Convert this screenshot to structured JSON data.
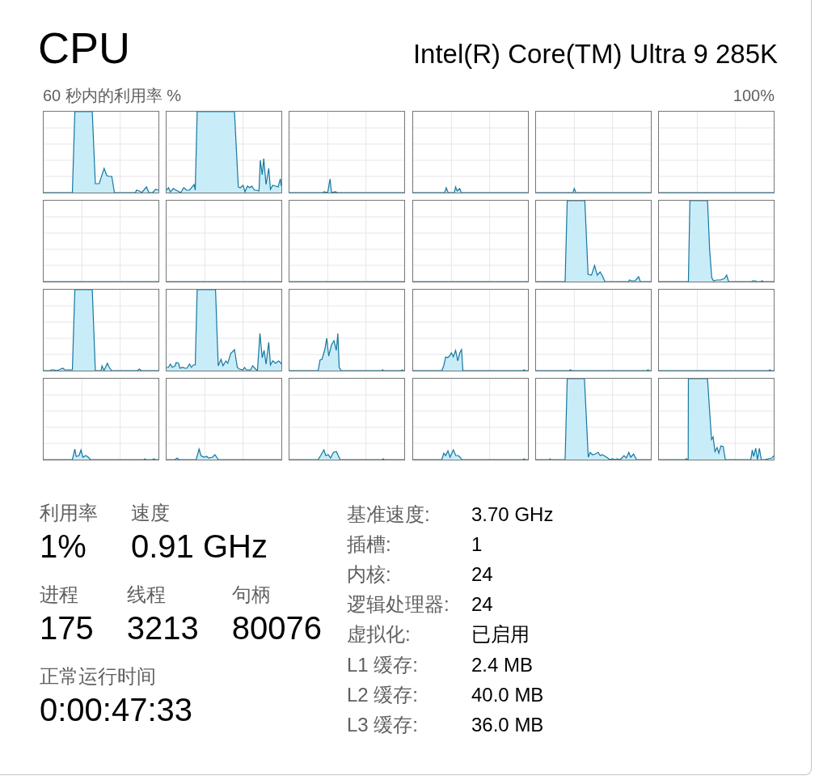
{
  "title": "CPU",
  "processor": "Intel(R) Core(TM) Ultra 9 285K",
  "graph_caption": {
    "label": "60 秒内的利用率 %",
    "max": "100%"
  },
  "stat_rows": [
    [
      {
        "label": "利用率",
        "value": "1%"
      },
      {
        "label": "速度",
        "value": "0.91 GHz"
      }
    ],
    [
      {
        "label": "进程",
        "value": "175"
      },
      {
        "label": "线程",
        "value": "3213"
      },
      {
        "label": "句柄",
        "value": "80076"
      }
    ],
    [
      {
        "label": "正常运行时间",
        "value": "0:00:47:33"
      }
    ]
  ],
  "details": [
    {
      "label": "基准速度:",
      "value": "3.70 GHz"
    },
    {
      "label": "插槽:",
      "value": "1"
    },
    {
      "label": "内核:",
      "value": "24"
    },
    {
      "label": "逻辑处理器:",
      "value": "24"
    },
    {
      "label": "虚拟化:",
      "value": "已启用"
    },
    {
      "label": "L1 缓存:",
      "value": "2.4 MB"
    },
    {
      "label": "L2 缓存:",
      "value": "40.0 MB"
    },
    {
      "label": "L3 缓存:",
      "value": "36.0 MB"
    }
  ]
}
